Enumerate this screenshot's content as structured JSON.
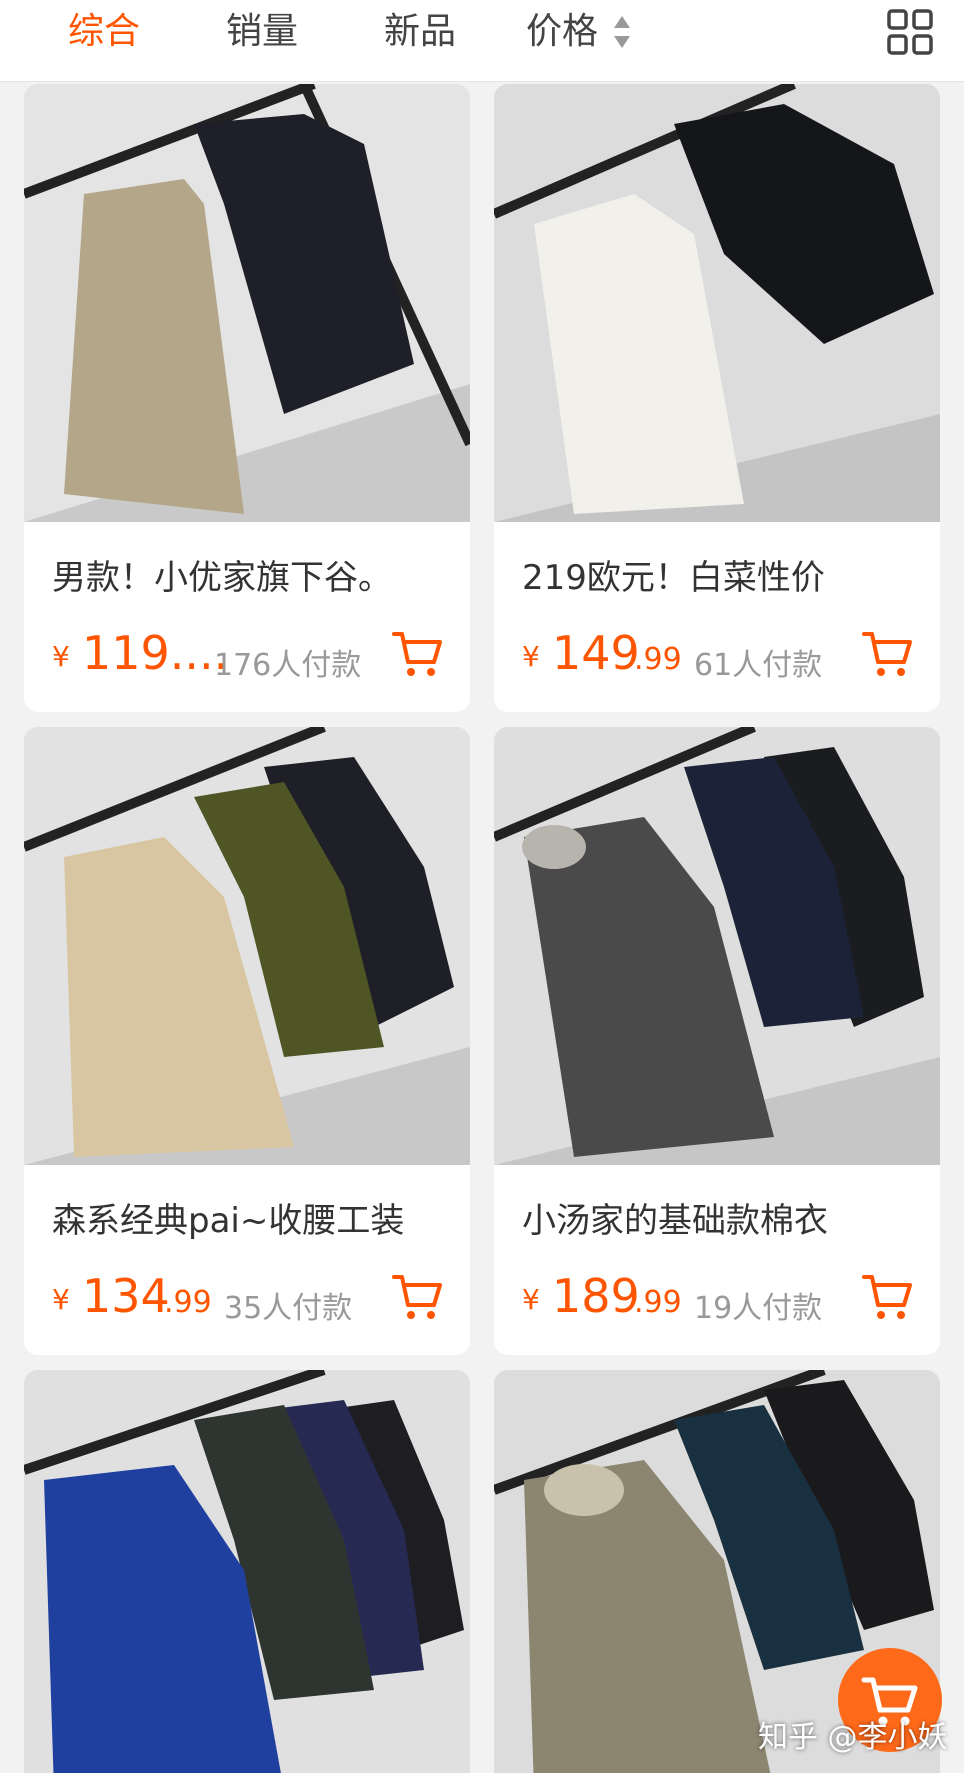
{
  "sort_tabs": [
    {
      "label": "综合",
      "active": true
    },
    {
      "label": "销量",
      "active": false
    },
    {
      "label": "新品",
      "active": false
    },
    {
      "label": "价格",
      "active": false
    }
  ],
  "colors": {
    "accent": "#ff5500",
    "muted": "#999999",
    "text": "#333333"
  },
  "icons": {
    "grid_toggle": "grid-view-icon",
    "sort": "sort-arrows-icon",
    "cart": "shopping-cart-icon"
  },
  "products": [
    {
      "title": "男款！小优家旗下谷。",
      "currency": "¥",
      "price_int": "119....",
      "price_dec": "",
      "sold": "176人付款"
    },
    {
      "title": "219欧元！白菜性价",
      "currency": "¥",
      "price_int": "149",
      "price_dec": ".99",
      "sold": "61人付款"
    },
    {
      "title": "森系经典pai~收腰工装",
      "currency": "¥",
      "price_int": "134",
      "price_dec": ".99",
      "sold": "35人付款"
    },
    {
      "title": "小汤家的基础款棉衣",
      "currency": "¥",
      "price_int": "189",
      "price_dec": ".99",
      "sold": "19人付款"
    },
    {
      "title": "",
      "currency": "",
      "price_int": "",
      "price_dec": "",
      "sold": ""
    },
    {
      "title": "",
      "currency": "",
      "price_int": "",
      "price_dec": "",
      "sold": ""
    }
  ],
  "watermark": "知乎 @李小妖"
}
